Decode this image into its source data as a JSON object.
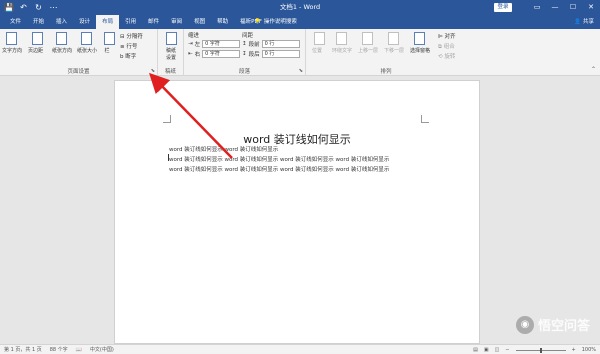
{
  "titlebar": {
    "title": "文档1 - Word",
    "login": "登录",
    "qat": [
      "💾",
      "↶",
      "↻",
      "⋯"
    ],
    "controls": [
      "▭",
      "—",
      "☐",
      "✕"
    ]
  },
  "tabs": [
    "文件",
    "开始",
    "插入",
    "设计",
    "布局",
    "引用",
    "邮件",
    "审阅",
    "视图",
    "帮助",
    "福昕PDF"
  ],
  "active_tab_index": 4,
  "tell_me": "操作说明搜索",
  "share": "共享",
  "ribbon": {
    "page_setup": {
      "label": "页面设置",
      "buttons": [
        "文字方向",
        "页边距",
        "纸张方向",
        "纸张大小",
        "栏"
      ],
      "small": [
        "分隔符",
        "行号",
        "断字"
      ]
    },
    "draft": {
      "label": "稿纸",
      "button": "稿纸设置"
    },
    "paragraph": {
      "label": "段落",
      "indent": "缩进",
      "spacing": "间距",
      "left_label": "左",
      "right_label": "右",
      "before_label": "段前",
      "after_label": "段后",
      "left_value": "0 字符",
      "right_value": "0 字符",
      "before_value": "0 行",
      "after_value": "0 行"
    },
    "arrange": {
      "label": "排列",
      "buttons": [
        "位置",
        "环绕文字",
        "上移一层",
        "下移一层",
        "选择窗格"
      ],
      "small": [
        "对齐",
        "组合",
        "旋转"
      ]
    }
  },
  "document": {
    "title": "word 装订线如何显示",
    "lines": [
      "word 装订线如何显示 word 装订线如何显示",
      "word 装订线如何显示 word 装订线如何显示 word 装订线如何显示 word 装订线如何显示",
      "word 装订线如何显示 word 装订线如何显示 word 装订线如何显示 word 装订线如何显示"
    ]
  },
  "status": {
    "page": "第 1 页，共 1 页",
    "words": "88 个字",
    "language": "中文(中国)",
    "zoom": "100%"
  },
  "watermark": "悟空问答",
  "colors": {
    "accent": "#2b579a",
    "arrow": "#e02020"
  }
}
